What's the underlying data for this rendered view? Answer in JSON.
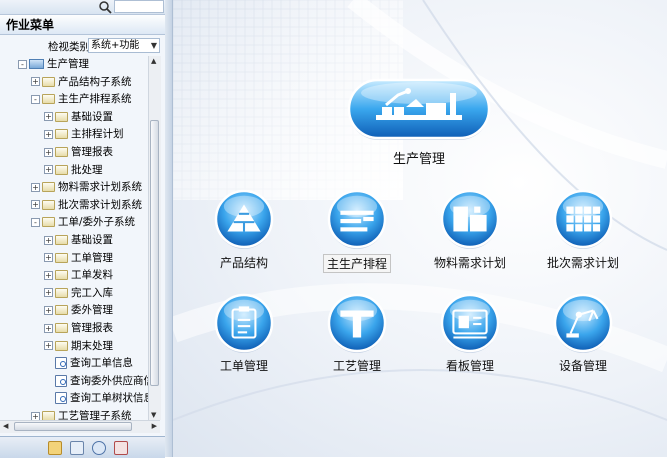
{
  "panel": {
    "title": "作业菜单",
    "category_label": "检视类别",
    "category_value": "系统+功能"
  },
  "tree": [
    {
      "label": "生产管理",
      "indent": 0,
      "toggle": "-",
      "icon": "root-icon"
    },
    {
      "label": "产品结构子系统",
      "indent": 1,
      "toggle": "+",
      "icon": "folder-icon"
    },
    {
      "label": "主生产排程系统",
      "indent": 1,
      "toggle": "-",
      "icon": "folder-icon"
    },
    {
      "label": "基础设置",
      "indent": 2,
      "toggle": "+",
      "icon": "folder-icon"
    },
    {
      "label": "主排程计划",
      "indent": 2,
      "toggle": "+",
      "icon": "folder-icon"
    },
    {
      "label": "管理报表",
      "indent": 2,
      "toggle": "+",
      "icon": "folder-icon"
    },
    {
      "label": "批处理",
      "indent": 2,
      "toggle": "+",
      "icon": "folder-icon"
    },
    {
      "label": "物料需求计划系统",
      "indent": 1,
      "toggle": "+",
      "icon": "folder-icon"
    },
    {
      "label": "批次需求计划系统",
      "indent": 1,
      "toggle": "+",
      "icon": "folder-icon"
    },
    {
      "label": "工单/委外子系统",
      "indent": 1,
      "toggle": "-",
      "icon": "folder-icon"
    },
    {
      "label": "基础设置",
      "indent": 2,
      "toggle": "+",
      "icon": "folder-icon"
    },
    {
      "label": "工单管理",
      "indent": 2,
      "toggle": "+",
      "icon": "folder-icon"
    },
    {
      "label": "工单发料",
      "indent": 2,
      "toggle": "+",
      "icon": "folder-icon"
    },
    {
      "label": "完工入库",
      "indent": 2,
      "toggle": "+",
      "icon": "folder-icon"
    },
    {
      "label": "委外管理",
      "indent": 2,
      "toggle": "+",
      "icon": "folder-icon"
    },
    {
      "label": "管理报表",
      "indent": 2,
      "toggle": "+",
      "icon": "folder-icon"
    },
    {
      "label": "期末处理",
      "indent": 2,
      "toggle": "+",
      "icon": "folder-icon"
    },
    {
      "label": "查询工单信息",
      "indent": 2,
      "toggle": "",
      "icon": "query-icon"
    },
    {
      "label": "查询委外供应商信",
      "indent": 2,
      "toggle": "",
      "icon": "query-icon"
    },
    {
      "label": "查询工单树状信息",
      "indent": 2,
      "toggle": "",
      "icon": "query-icon"
    },
    {
      "label": "工艺管理子系统",
      "indent": 1,
      "toggle": "+",
      "icon": "folder-icon"
    }
  ],
  "main": {
    "hero": {
      "label": "生产管理",
      "icon": "factory-icon"
    },
    "modules": [
      {
        "label": "产品结构",
        "icon": "pyramid-icon",
        "selected": false
      },
      {
        "label": "主生产排程",
        "icon": "schedule-icon",
        "selected": true
      },
      {
        "label": "物料需求计划",
        "icon": "material-icon",
        "selected": false
      },
      {
        "label": "批次需求计划",
        "icon": "grid-icon",
        "selected": false
      },
      {
        "label": "工单管理",
        "icon": "clipboard-icon",
        "selected": false
      },
      {
        "label": "工艺管理",
        "icon": "tool-icon",
        "selected": false
      },
      {
        "label": "看板管理",
        "icon": "board-icon",
        "selected": false
      },
      {
        "label": "设备管理",
        "icon": "robot-arm-icon",
        "selected": false
      }
    ]
  },
  "colors": {
    "accent": "#2c9ee6",
    "accent_dark": "#0f5fb6",
    "panel_bg": "#f2f6fb"
  }
}
